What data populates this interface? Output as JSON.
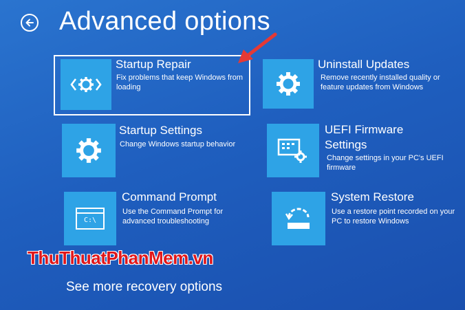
{
  "header": {
    "title": "Advanced options"
  },
  "tiles": [
    {
      "title": "Startup Repair",
      "desc": "Fix problems that keep Windows from loading",
      "icon": "code-gear-icon"
    },
    {
      "title": "Uninstall Updates",
      "desc": "Remove recently installed quality or feature updates from Windows",
      "icon": "gear-icon"
    },
    {
      "title": "Startup Settings",
      "desc": "Change Windows startup behavior",
      "icon": "gear-icon"
    },
    {
      "title": "UEFI Firmware Settings",
      "desc": "Change settings in your PC's UEFI firmware",
      "icon": "firmware-chip-icon"
    },
    {
      "title": "Command Prompt",
      "desc": "Use the Command Prompt for advanced troubleshooting",
      "icon": "command-prompt-icon",
      "prompt_text": "C:\\"
    },
    {
      "title": "System Restore",
      "desc": "Use a restore point recorded on your PC to restore Windows",
      "icon": "restore-icon"
    }
  ],
  "footer": {
    "more_link": "See more recovery options"
  },
  "watermark": {
    "part1": "ThuThuat",
    "part2": "PhanMem",
    "part3": ".vn"
  },
  "colors": {
    "background": "#1f5fbf",
    "tile": "#2ea3e6",
    "arrow": "#e53935",
    "watermark": "#e0161a"
  }
}
